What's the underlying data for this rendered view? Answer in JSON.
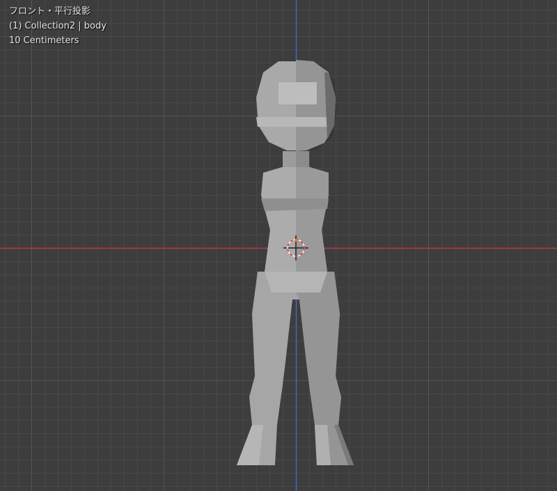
{
  "viewport": {
    "view_name": "フロント・平行投影",
    "object_info": "(1) Collection2 | body",
    "grid_scale": "10 Centimeters"
  },
  "colors": {
    "background": "#3d3d3d",
    "grid_minor": "#484848",
    "grid_major": "#555555",
    "x_axis": "#9b3a47",
    "z_axis": "#3a6fc0",
    "mesh": "#a4a4a4"
  },
  "icons": [
    "3d-cursor-icon"
  ]
}
